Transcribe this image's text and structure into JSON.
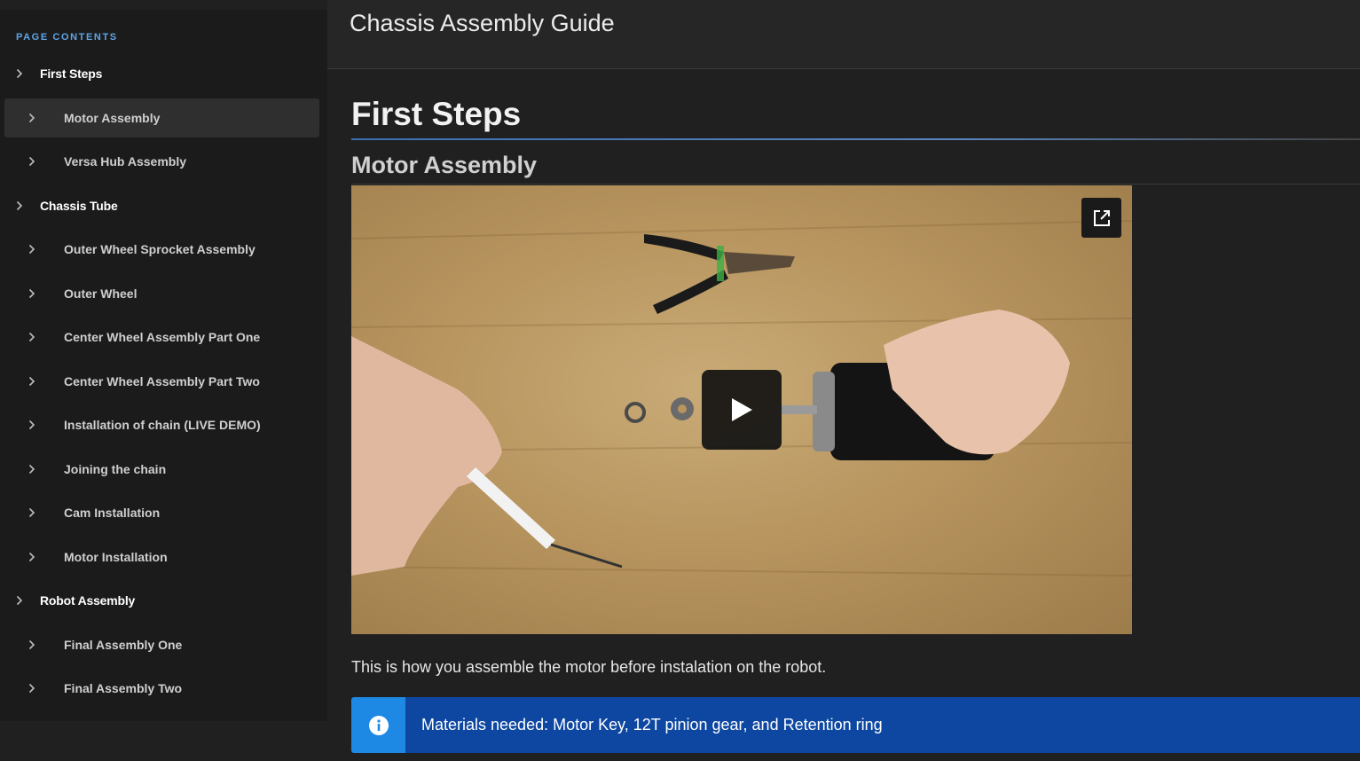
{
  "header": {
    "title": "Chassis Assembly Guide"
  },
  "toc": {
    "heading": "PAGE CONTENTS",
    "items": [
      {
        "label": "First Steps",
        "level": 1
      },
      {
        "label": "Motor Assembly",
        "level": 2,
        "active": true
      },
      {
        "label": "Versa Hub Assembly",
        "level": 2
      },
      {
        "label": "Chassis Tube",
        "level": 1
      },
      {
        "label": "Outer Wheel Sprocket Assembly",
        "level": 2
      },
      {
        "label": "Outer Wheel",
        "level": 2
      },
      {
        "label": "Center Wheel Assembly Part One",
        "level": 2
      },
      {
        "label": "Center Wheel Assembly Part Two",
        "level": 2
      },
      {
        "label": "Installation of chain (LIVE DEMO)",
        "level": 2
      },
      {
        "label": "Joining the chain",
        "level": 2
      },
      {
        "label": "Cam Installation",
        "level": 2
      },
      {
        "label": "Motor Installation",
        "level": 2
      },
      {
        "label": "Robot Assembly",
        "level": 1
      },
      {
        "label": "Final Assembly One",
        "level": 2
      },
      {
        "label": "Final Assembly Two",
        "level": 2
      }
    ]
  },
  "content": {
    "section_title": "First Steps",
    "subsection_title": "Motor Assembly",
    "video": {
      "play_icon": "play-icon",
      "popout_icon": "open-external-icon"
    },
    "caption": "This is how you assemble the motor before instalation on the robot.",
    "callout": {
      "icon": "info-icon",
      "text": "Materials needed: Motor Key, 12T pinion gear, and Retention ring"
    }
  },
  "colors": {
    "accent": "#5fa4e6",
    "callout_bg": "#0d47a1",
    "callout_icon_bg": "#1e88e5"
  }
}
